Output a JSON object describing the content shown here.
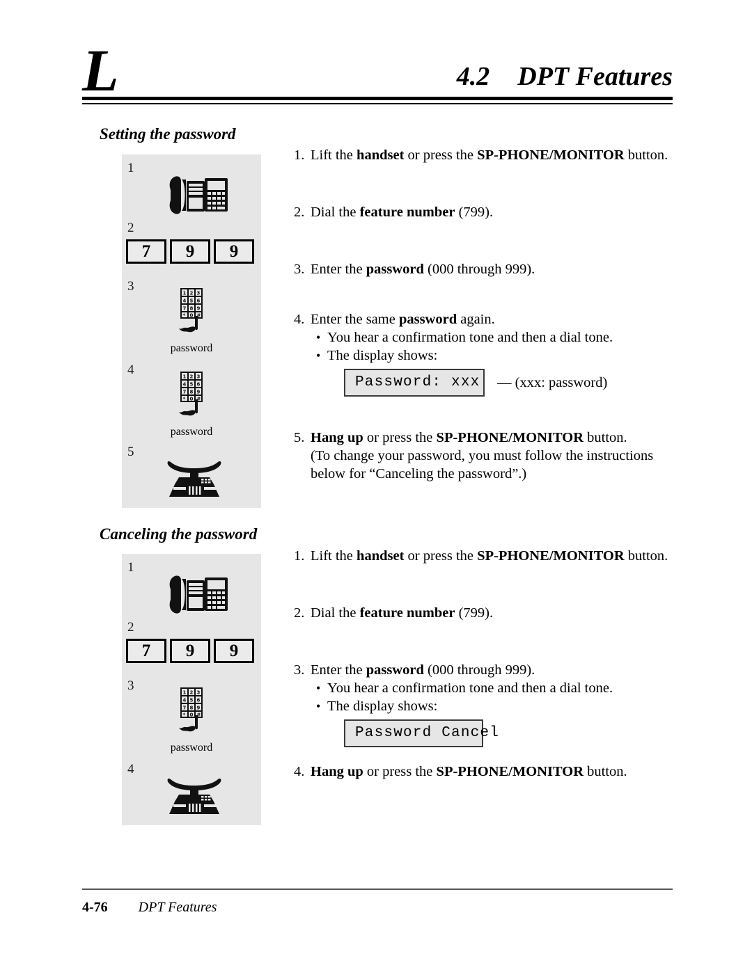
{
  "header": {
    "letter": "L",
    "section_number": "4.2",
    "section_title": "DPT Features"
  },
  "sections": [
    {
      "heading": "Setting the password",
      "diagram_steps": [
        {
          "num": "1",
          "icon": "lift-handset-icon",
          "caption": ""
        },
        {
          "num": "2",
          "icon": "feature-number-keys",
          "keys": [
            "7",
            "9",
            "9"
          ],
          "caption": ""
        },
        {
          "num": "3",
          "icon": "keypad-icon",
          "caption": "password"
        },
        {
          "num": "4",
          "icon": "keypad-icon",
          "caption": "password"
        },
        {
          "num": "5",
          "icon": "hang-up-icon",
          "caption": ""
        }
      ],
      "steps": [
        {
          "num": "1.",
          "text_html": "Lift the <b>handset</b> or press the <b>SP-PHONE/MONITOR</b> button."
        },
        {
          "num": "2.",
          "text_html": "Dial the <b>feature number</b> (799)."
        },
        {
          "num": "3.",
          "text_html": "Enter the <b>password</b> (000 through 999)."
        },
        {
          "num": "4.",
          "text_html": "Enter the same <b>password</b> again.",
          "bullets": [
            "You hear a confirmation tone and then a dial tone.",
            "The display shows:"
          ],
          "display": "Password: xxx",
          "display_note": "— (xxx: password)"
        },
        {
          "num": "5.",
          "text_html": "<b>Hang up</b> or press the <b>SP-PHONE/MONITOR</b> button.",
          "extra_lines": [
            "(To change your password, you must follow the instructions",
            "below for “Canceling the password”.)"
          ]
        }
      ]
    },
    {
      "heading": "Canceling the password",
      "diagram_steps": [
        {
          "num": "1",
          "icon": "lift-handset-icon",
          "caption": ""
        },
        {
          "num": "2",
          "icon": "feature-number-keys",
          "keys": [
            "7",
            "9",
            "9"
          ],
          "caption": ""
        },
        {
          "num": "3",
          "icon": "keypad-icon",
          "caption": "password"
        },
        {
          "num": "4",
          "icon": "hang-up-icon",
          "caption": ""
        }
      ],
      "steps": [
        {
          "num": "1.",
          "text_html": "Lift the <b>handset</b> or press the <b>SP-PHONE/MONITOR</b> button."
        },
        {
          "num": "2.",
          "text_html": "Dial the <b>feature number</b> (799)."
        },
        {
          "num": "3.",
          "text_html": "Enter the <b>password</b> (000 through 999).",
          "bullets": [
            "You hear a confirmation tone and then a dial tone.",
            "The display shows:"
          ],
          "display": "Password Cancel",
          "display_note": ""
        },
        {
          "num": "4.",
          "text_html": "<b>Hang up</b> or press the <b>SP-PHONE/MONITOR</b> button."
        }
      ]
    }
  ],
  "keypad": {
    "rows": [
      [
        "1",
        "2",
        "3"
      ],
      [
        "4",
        "5",
        "6"
      ],
      [
        "7",
        "8",
        "9"
      ],
      [
        "✳",
        "0",
        "#"
      ]
    ]
  },
  "footer": {
    "page_number": "4-76",
    "title": "DPT Features"
  },
  "colors": {
    "panel_background": "#e6e6e6",
    "display_background": "#e6e6e6",
    "text": "#000000",
    "rule": "#000000"
  }
}
